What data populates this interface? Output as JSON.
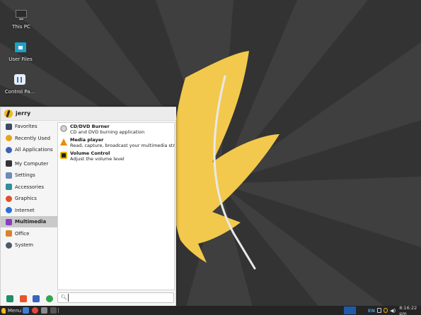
{
  "desktop": {
    "icons": [
      {
        "label": "This PC",
        "icon": "monitor-icon"
      },
      {
        "label": "User Files",
        "icon": "folder-icon"
      },
      {
        "label": "Control Pa...",
        "icon": "control-panel-icon"
      }
    ]
  },
  "menu": {
    "user": "jerry",
    "categories": [
      {
        "label": "Favorites",
        "icon": "bookmark-icon",
        "color": "#3b4a66"
      },
      {
        "label": "Recently Used",
        "icon": "clock-icon",
        "color": "#e8a31c"
      },
      {
        "label": "All Applications",
        "icon": "grid-icon",
        "color": "#3a63b8"
      },
      {
        "label": "My Computer",
        "icon": "monitor-icon",
        "color": "#333333"
      },
      {
        "label": "Settings",
        "icon": "settings-icon",
        "color": "#6c8ab8"
      },
      {
        "label": "Accessories",
        "icon": "accessories-icon",
        "color": "#2f8f9a"
      },
      {
        "label": "Graphics",
        "icon": "graphics-icon",
        "color": "#e0502a"
      },
      {
        "label": "Internet",
        "icon": "globe-icon",
        "color": "#2d6fd6"
      },
      {
        "label": "Multimedia",
        "icon": "multimedia-icon",
        "color": "#8a3cc2"
      },
      {
        "label": "Office",
        "icon": "briefcase-icon",
        "color": "#d9822b"
      },
      {
        "label": "System",
        "icon": "gear-icon",
        "color": "#4a5a6a"
      }
    ],
    "active_category": "Multimedia",
    "apps": [
      {
        "name": "CD/DVD Burner",
        "desc": "CD and DVD burning application",
        "icon": "disc-icon",
        "color": "#cfcfcf"
      },
      {
        "name": "Media player",
        "desc": "Read, capture, broadcast your multimedia strea...",
        "icon": "vlc-cone-icon",
        "color": "#f08a00"
      },
      {
        "name": "Volume Control",
        "desc": "Adjust the volume level",
        "icon": "speaker-icon",
        "color": "#e6b000"
      }
    ],
    "quick_launch": [
      {
        "icon": "software-center-icon",
        "color": "#1e8f6a"
      },
      {
        "icon": "store-icon",
        "color": "#e8542a"
      },
      {
        "icon": "settings-manager-icon",
        "color": "#3566c2"
      },
      {
        "icon": "refresh-icon",
        "color": "#2ea84a"
      }
    ],
    "search": {
      "placeholder": ""
    }
  },
  "taskbar": {
    "menu_label": "Menu",
    "launchers": [
      {
        "icon": "files-icon",
        "color": "#3a80d6"
      },
      {
        "icon": "chrome-icon",
        "color": "#e04a3a"
      },
      {
        "icon": "file-manager-icon",
        "color": "#8a8a8a"
      },
      {
        "icon": "terminal-icon",
        "color": "#555555"
      }
    ],
    "tray": {
      "language": "EN",
      "time": "8:16:22 pm"
    }
  },
  "colors": {
    "accent": "#f2b81c",
    "wallpaper_dark": "#2f2f2f",
    "wallpaper_light": "#4a4a4a",
    "taskbar_active": "#1f5aa8"
  }
}
